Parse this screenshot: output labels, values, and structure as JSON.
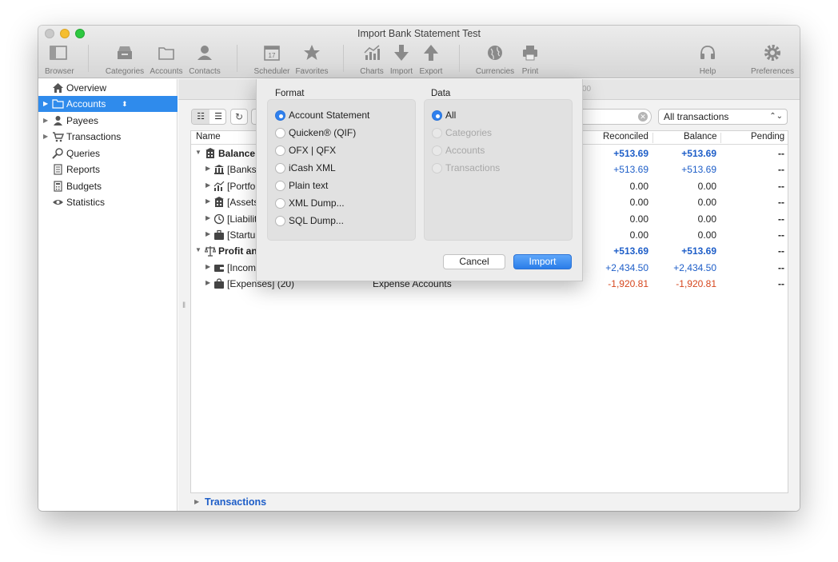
{
  "window": {
    "title": "Import Bank Statement Test"
  },
  "toolbar": {
    "items": [
      {
        "label": "Browser",
        "icon": "browser-icon"
      },
      {
        "label": "Categories",
        "icon": "categories-icon"
      },
      {
        "label": "Accounts",
        "icon": "accounts-folder-icon"
      },
      {
        "label": "Contacts",
        "icon": "contacts-icon"
      },
      {
        "label": "Scheduler",
        "icon": "calendar-icon"
      },
      {
        "label": "Favorites",
        "icon": "star-icon"
      },
      {
        "label": "Charts",
        "icon": "chart-icon"
      },
      {
        "label": "Import",
        "icon": "arrow-down-icon"
      },
      {
        "label": "Export",
        "icon": "arrow-up-icon"
      },
      {
        "label": "Currencies",
        "icon": "globe-icon"
      },
      {
        "label": "Print",
        "icon": "printer-icon"
      },
      {
        "label": "Help",
        "icon": "headset-icon"
      },
      {
        "label": "Preferences",
        "icon": "gear-icon"
      }
    ],
    "scheduler_day": "17"
  },
  "sidebar": {
    "items": [
      {
        "label": "Overview",
        "icon": "house-icon",
        "expandable": false
      },
      {
        "label": "Accounts",
        "icon": "folder-icon",
        "expandable": true,
        "selected": true
      },
      {
        "label": "Payees",
        "icon": "person-icon",
        "expandable": true
      },
      {
        "label": "Transactions",
        "icon": "cart-icon",
        "expandable": true
      },
      {
        "label": "Queries",
        "icon": "magnifier-icon",
        "expandable": false
      },
      {
        "label": "Reports",
        "icon": "report-icon",
        "expandable": false
      },
      {
        "label": "Budgets",
        "icon": "calculator-icon",
        "expandable": false
      },
      {
        "label": "Statistics",
        "icon": "eye-icon",
        "expandable": false
      }
    ]
  },
  "content": {
    "crumb_fragment": "00",
    "filter": {
      "selected": "All transactions"
    },
    "columns": {
      "name": "Name",
      "reconciled": "Reconciled",
      "balance": "Balance",
      "pending": "Pending"
    },
    "rows": [
      {
        "name": "Balance",
        "level": 0,
        "bold": true,
        "icon": "building-icon",
        "reconciled": "+513.69",
        "balance": "+513.69",
        "pending": "--",
        "color": "blue-bold"
      },
      {
        "name": "[Banks]",
        "level": 1,
        "bold": false,
        "icon": "bank-icon",
        "reconciled": "+513.69",
        "balance": "+513.69",
        "pending": "--",
        "color": "blue"
      },
      {
        "name": "[Portfol",
        "level": 1,
        "bold": false,
        "icon": "chart-icon",
        "reconciled": "0.00",
        "balance": "0.00",
        "pending": "--",
        "color": "black"
      },
      {
        "name": "[Assets",
        "level": 1,
        "bold": false,
        "icon": "building-icon",
        "reconciled": "0.00",
        "balance": "0.00",
        "pending": "--",
        "color": "black"
      },
      {
        "name": "[Liabilit",
        "level": 1,
        "bold": false,
        "icon": "clock-icon",
        "reconciled": "0.00",
        "balance": "0.00",
        "pending": "--",
        "color": "black"
      },
      {
        "name": "[Startup",
        "level": 1,
        "bold": false,
        "icon": "briefcase-icon",
        "reconciled": "0.00",
        "balance": "0.00",
        "pending": "--",
        "color": "black"
      },
      {
        "name": "Profit and",
        "level": 0,
        "bold": true,
        "icon": "scales-icon",
        "reconciled": "+513.69",
        "balance": "+513.69",
        "pending": "--",
        "color": "blue-bold"
      },
      {
        "name": "[Income",
        "level": 1,
        "bold": false,
        "icon": "wallet-icon",
        "reconciled": "+2,434.50",
        "balance": "+2,434.50",
        "pending": "--",
        "color": "blue"
      },
      {
        "name": "[Expenses] (20)",
        "level": 1,
        "bold": false,
        "icon": "bag-icon",
        "type": "Expense Accounts",
        "reconciled": "-1,920.81",
        "balance": "-1,920.81",
        "pending": "--",
        "color": "red"
      }
    ],
    "bottom_section": "Transactions"
  },
  "dialog": {
    "format": {
      "title": "Format",
      "options": [
        {
          "label": "Account Statement",
          "selected": true,
          "disabled": false
        },
        {
          "label": "Quicken® (QIF)",
          "selected": false,
          "disabled": false
        },
        {
          "label": "OFX | QFX",
          "selected": false,
          "disabled": false
        },
        {
          "label": "iCash XML",
          "selected": false,
          "disabled": false
        },
        {
          "label": "Plain text",
          "selected": false,
          "disabled": false
        },
        {
          "label": "XML Dump...",
          "selected": false,
          "disabled": false
        },
        {
          "label": "SQL Dump...",
          "selected": false,
          "disabled": false
        }
      ]
    },
    "data": {
      "title": "Data",
      "options": [
        {
          "label": "All",
          "selected": true,
          "disabled": false
        },
        {
          "label": "Categories",
          "selected": false,
          "disabled": true
        },
        {
          "label": "Accounts",
          "selected": false,
          "disabled": true
        },
        {
          "label": "Transactions",
          "selected": false,
          "disabled": true
        }
      ]
    },
    "cancel_label": "Cancel",
    "import_label": "Import"
  }
}
